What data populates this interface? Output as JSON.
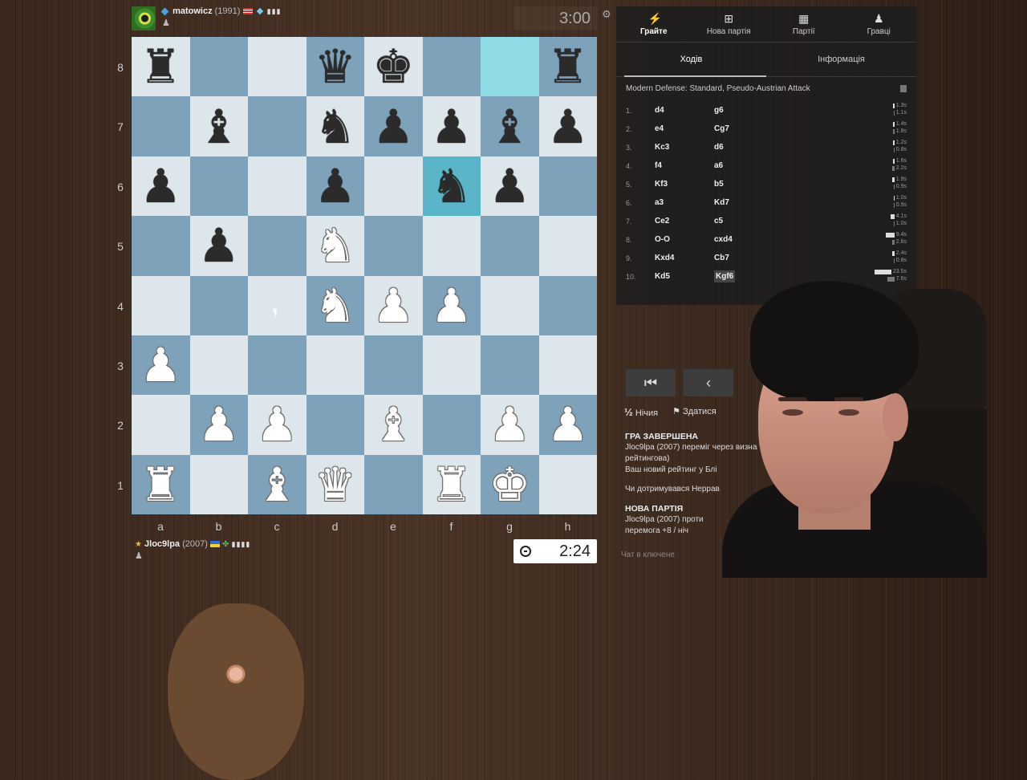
{
  "top_player": {
    "name": "matowicz",
    "rating": "(1991)",
    "clock": "3:00"
  },
  "bottom_player": {
    "name": "Jloc9lpa",
    "rating": "(2007)",
    "clock": "2:24"
  },
  "board": {
    "ranks": [
      "8",
      "7",
      "6",
      "5",
      "4",
      "3",
      "2",
      "1"
    ],
    "files": [
      "a",
      "b",
      "c",
      "d",
      "e",
      "f",
      "g",
      "h"
    ],
    "position": [
      [
        "bR",
        "",
        "",
        "bQ",
        "bK",
        "",
        "",
        "bR"
      ],
      [
        "",
        "bB",
        "",
        "bN",
        "bP",
        "bP",
        "bB",
        "bP"
      ],
      [
        "bP",
        "",
        "",
        "bP",
        "",
        "bN",
        "bP",
        ""
      ],
      [
        "",
        "bP",
        "",
        "wN",
        "",
        "",
        "",
        ""
      ],
      [
        "",
        "",
        "",
        "wN",
        "wP",
        "wP",
        "",
        ""
      ],
      [
        "wP",
        "",
        "",
        "",
        "",
        "",
        "",
        ""
      ],
      [
        "",
        "wP",
        "wP",
        "",
        "wB",
        "",
        "wP",
        "wP"
      ],
      [
        "wR",
        "",
        "wB",
        "wQ",
        "",
        "wR",
        "wK",
        ""
      ]
    ],
    "highlight": [
      "g8",
      "f6"
    ],
    "colors": {
      "light": "#dde6ea",
      "dark": "#7fa2bb",
      "highlight_light": "#8fdbe6",
      "highlight_dark": "#5bb5c8"
    }
  },
  "nav": {
    "items": [
      {
        "label": "Грайте",
        "icon": "lightning-icon"
      },
      {
        "label": "Нова партія",
        "icon": "plus-square-icon"
      },
      {
        "label": "Партії",
        "icon": "board-icon"
      },
      {
        "label": "Гравці",
        "icon": "players-icon"
      }
    ]
  },
  "tabs": {
    "moves": "Ходів",
    "info": "Інформація"
  },
  "opening": "Modern Defense: Standard, Pseudo-Austrian Attack",
  "moves": [
    {
      "n": "1.",
      "w": "d4",
      "b": "g6",
      "tw": "1.3s",
      "tb": "1.1s",
      "ww": 2,
      "wb": 1
    },
    {
      "n": "2.",
      "w": "e4",
      "b": "Cg7",
      "tw": "1.4s",
      "tb": "1.8s",
      "ww": 2,
      "wb": 2
    },
    {
      "n": "3.",
      "w": "Kc3",
      "b": "d6",
      "tw": "1.2s",
      "tb": "0.8s",
      "ww": 2,
      "wb": 1
    },
    {
      "n": "4.",
      "w": "f4",
      "b": "a6",
      "tw": "1.6s",
      "tb": "2.2s",
      "ww": 2,
      "wb": 3
    },
    {
      "n": "5.",
      "w": "Kf3",
      "b": "b5",
      "tw": "1.9s",
      "tb": "0.9s",
      "ww": 3,
      "wb": 1
    },
    {
      "n": "6.",
      "w": "a3",
      "b": "Kd7",
      "tw": "1.0s",
      "tb": "0.9s",
      "ww": 1,
      "wb": 1
    },
    {
      "n": "7.",
      "w": "Ce2",
      "b": "c5",
      "tw": "4.1s",
      "tb": "1.0s",
      "ww": 5,
      "wb": 1
    },
    {
      "n": "8.",
      "w": "O-O",
      "b": "cxd4",
      "tw": "9.4s",
      "tb": "2.6s",
      "ww": 11,
      "wb": 3
    },
    {
      "n": "9.",
      "w": "Kxd4",
      "b": "Cb7",
      "tw": "2.4s",
      "tb": "0.8s",
      "ww": 3,
      "wb": 1
    },
    {
      "n": "10.",
      "w": "Kd5",
      "b": "Kgf6",
      "tw": "23.5s",
      "tb": "7.6s",
      "ww": 22,
      "wb": 9
    }
  ],
  "controls": {
    "first": "K",
    "prev": "‹"
  },
  "actions": {
    "draw_symbol": "½",
    "draw": "Нічия",
    "resign": "Здатися"
  },
  "status": {
    "game_over": "ГРА ЗАВЕРШЕНА",
    "line1": "Jloc9lpa (2007) переміг через визна",
    "line2": "рейтингова)",
    "line3": "Ваш новий рейтинг у Блі",
    "question": "Чи дотримувався Неррав",
    "new_game": "НОВА ПАРТІЯ",
    "line4": "Jloc9lpa (2007) проти",
    "line5": "перемога +8 / ніч"
  },
  "chat_placeholder": "Чат в ключене"
}
